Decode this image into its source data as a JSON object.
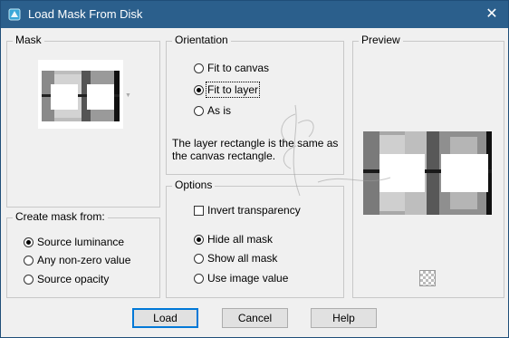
{
  "window": {
    "title": "Load Mask From Disk",
    "close_icon": "close-icon"
  },
  "mask_group": {
    "legend": "Mask"
  },
  "create_mask_group": {
    "legend": "Create mask from:",
    "options": [
      {
        "label": "Source luminance",
        "selected": true
      },
      {
        "label": "Any non-zero value",
        "selected": false
      },
      {
        "label": "Source opacity",
        "selected": false
      }
    ]
  },
  "orientation_group": {
    "legend": "Orientation",
    "options": [
      {
        "label": "Fit to canvas",
        "selected": false
      },
      {
        "label": "Fit to layer",
        "selected": true
      },
      {
        "label": "As is",
        "selected": false
      }
    ],
    "description_line1": "The layer rectangle is the same as",
    "description_line2": "the canvas rectangle."
  },
  "options_group": {
    "legend": "Options",
    "invert_label": "Invert transparency",
    "invert_checked": false,
    "options": [
      {
        "label": "Hide all mask",
        "selected": true
      },
      {
        "label": "Show all mask",
        "selected": false
      },
      {
        "label": "Use image value",
        "selected": false
      }
    ]
  },
  "preview_group": {
    "legend": "Preview",
    "transparency_icon": "checkerboard-icon"
  },
  "buttons": {
    "load": "Load",
    "cancel": "Cancel",
    "help": "Help"
  },
  "colors": {
    "titlebar": "#2b5f8c",
    "dialog_bg": "#f0f0f0",
    "default_button_border": "#0078d7"
  }
}
